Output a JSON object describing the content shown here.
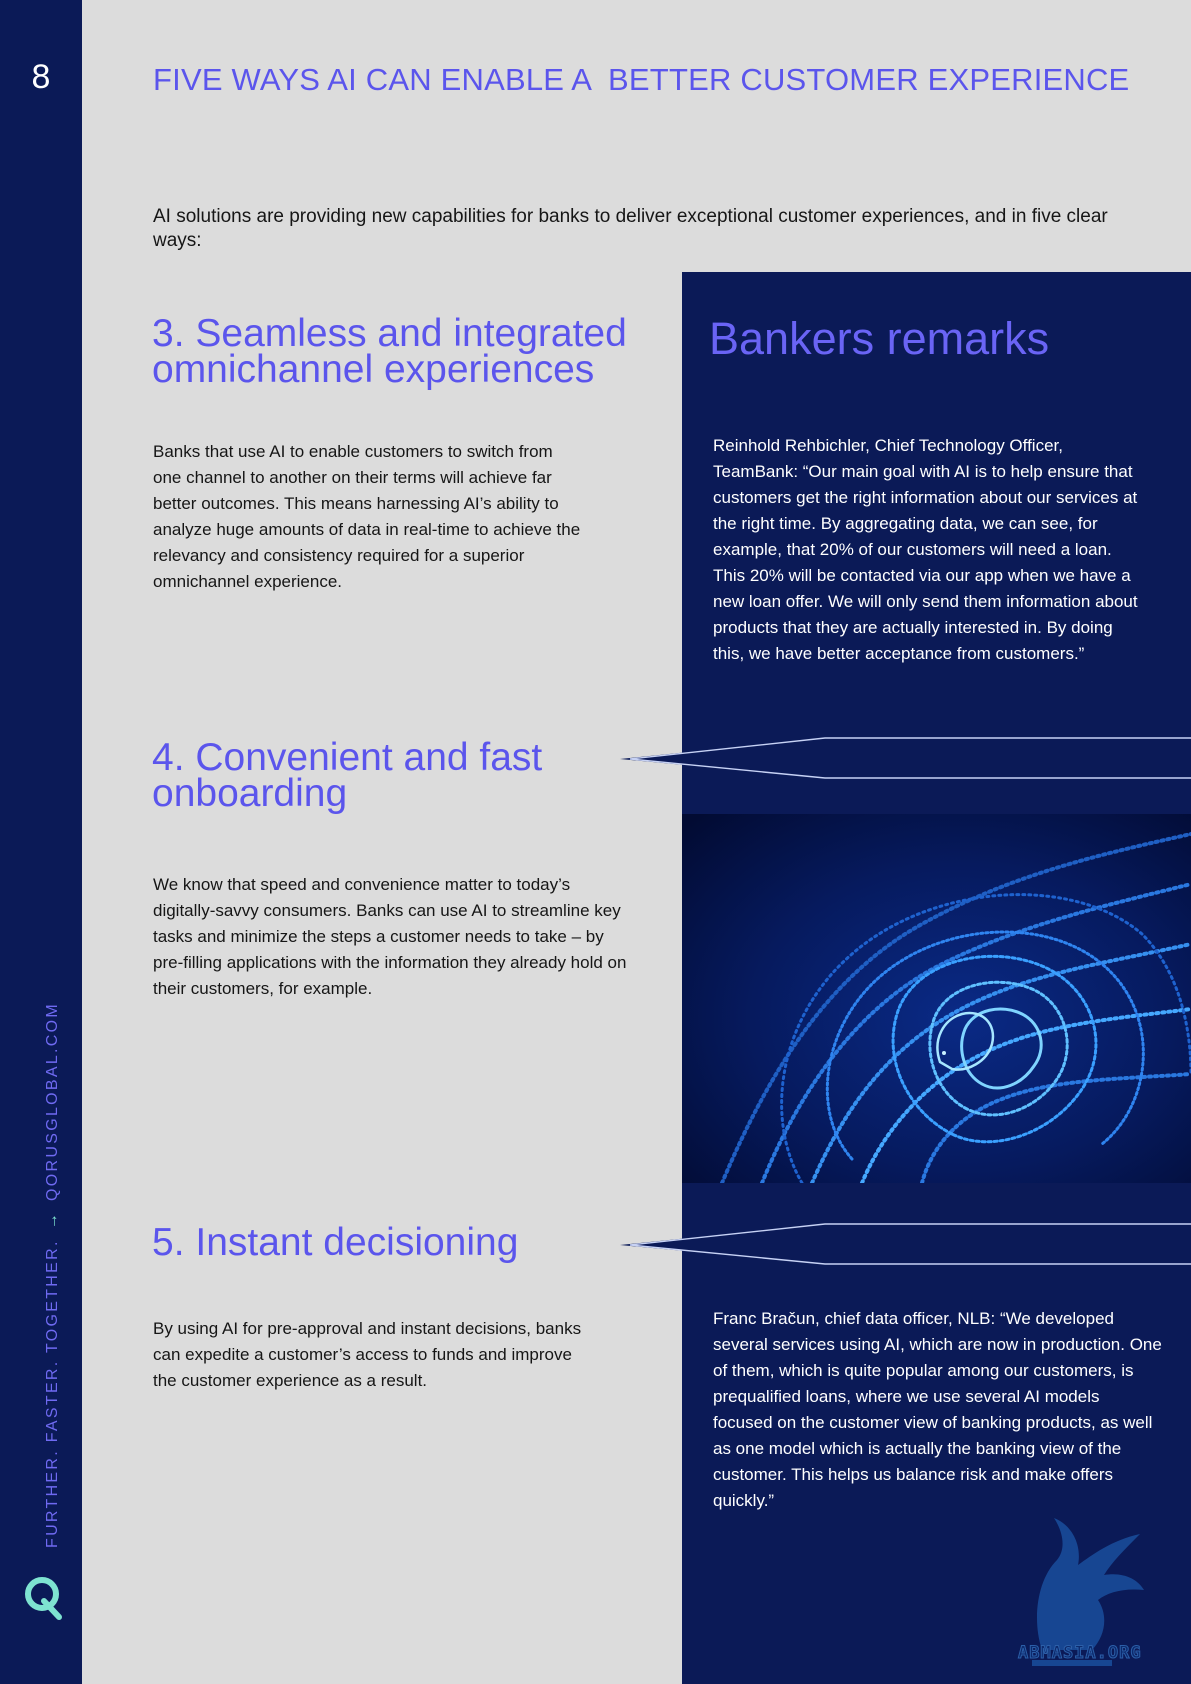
{
  "page": {
    "number": "8",
    "title": "FIVE WAYS AI CAN ENABLE A  BETTER CUSTOMER EXPERIENCE",
    "intro": "AI solutions are providing new capabilities for banks to deliver exceptional customer experiences, and in five clear ways:"
  },
  "rail": {
    "tagline": "FURTHER. FASTER. TOGETHER.",
    "arrow": "→",
    "website": "QORUSGLOBAL.COM",
    "logo_icon": "q-logo-icon"
  },
  "sections": [
    {
      "title": "3. Seamless and integrated omnichannel experiences",
      "body": "Banks that use AI to enable customers to switch from one channel to another on their terms will achieve far better outcomes. This means harnessing AI’s ability to analyze huge amounts of data in real-time to achieve the relevancy and consistency required for a superior omnichannel experience."
    },
    {
      "title": "4. Convenient and fast onboarding",
      "body": "We know that speed and convenience matter to today’s digitally-savvy consumers. Banks can use AI to streamline key tasks and minimize the steps a customer needs to take – by pre-filling applications with the information they already hold on their customers, for example."
    },
    {
      "title": "5. Instant decisioning",
      "body": "By using AI for pre-approval and instant decisions, banks can expedite a customer’s access to funds and improve the customer experience as a result."
    }
  ],
  "bankers_remarks": {
    "title": "Bankers remarks",
    "quotes": [
      "Reinhold Rehbichler, Chief Technology Officer, TeamBank:  “Our main goal with AI is to help ensure that customers get the right information about our services at the right time. By aggregating data, we can see, for example, that 20% of our customers will need a loan. This 20% will be contacted via our app when we have a new loan offer. We will only send them information about products that they are actually interested in. By doing this, we have better acceptance from customers.”",
      "Franc Bračun, chief data officer, NLB: “We developed several services using AI, which are now in production. One of them, which is quite popular among our customers, is prequalified loans, where we use several AI models focused on the customer view of banking products, as well as one model which is actually the banking view of the customer. This helps us balance risk and make offers quickly.”"
    ]
  },
  "watermark": {
    "text": "ABMASIA.ORG"
  },
  "colors": {
    "navy": "#0b1a57",
    "accent": "#5b55ec",
    "background": "#dcdcdc",
    "teal": "#7ee3d1"
  }
}
